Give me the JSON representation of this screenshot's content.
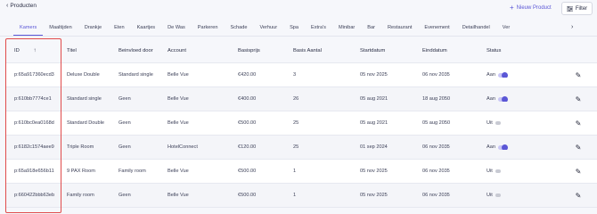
{
  "header": {
    "back_label": "Producten",
    "new_product_label": "Nieuw Product",
    "filter_label": "Filter"
  },
  "tabs": [
    {
      "label": "Kamers",
      "active": true
    },
    {
      "label": "Maaltijden"
    },
    {
      "label": "Drankje"
    },
    {
      "label": "Eten"
    },
    {
      "label": "Kaartjes"
    },
    {
      "label": "De Was"
    },
    {
      "label": "Parkeren"
    },
    {
      "label": "Schade"
    },
    {
      "label": "Verhuur"
    },
    {
      "label": "Spa"
    },
    {
      "label": "Extra's"
    },
    {
      "label": "Minibar"
    },
    {
      "label": "Bar"
    },
    {
      "label": "Restaurant"
    },
    {
      "label": "Evenement"
    },
    {
      "label": "Detailhandel"
    },
    {
      "label": "Ver"
    }
  ],
  "table": {
    "columns": {
      "id": "ID",
      "titel": "Titel",
      "beinvloed": "Beinvloed door",
      "account": "Account",
      "basisprijs": "Basisprijs",
      "aantal": "Basis Aantal",
      "start": "Startdatum",
      "eind": "Einddatum",
      "status": "Status"
    },
    "rows": [
      {
        "id": "p:65a917360ecd3",
        "titel": "Deluxe Double",
        "beinvloed": "Standard single",
        "account": "Belle Vue",
        "basisprijs": "€420.00",
        "aantal": "3",
        "start": "05 nov 2025",
        "eind": "06 nov 2035",
        "status": "Aan",
        "status_on": true
      },
      {
        "id": "p:610bb7774ce1",
        "titel": "Standard single",
        "beinvloed": "Geen",
        "account": "Belle Vue",
        "basisprijs": "€400.00",
        "aantal": "26",
        "start": "05 aug 2021",
        "eind": "18 aug 2050",
        "status": "Aan",
        "status_on": true
      },
      {
        "id": "p:610bc0ea0168d",
        "titel": "Standard Double",
        "beinvloed": "Geen",
        "account": "Belle Vue",
        "basisprijs": "€500.00",
        "aantal": "25",
        "start": "05 aug 2021",
        "eind": "05 aug 2050",
        "status": "Uit",
        "status_on": false
      },
      {
        "id": "p:6182c1574aee9",
        "titel": "Triple Room",
        "beinvloed": "Geen",
        "account": "HotelConnect",
        "basisprijs": "€120.00",
        "aantal": "25",
        "start": "01 sep 2024",
        "eind": "06 nov 2035",
        "status": "Aan",
        "status_on": true
      },
      {
        "id": "p:65a918e656b11",
        "titel": "9 PAX Room",
        "beinvloed": "Family room",
        "account": "Belle Vue",
        "basisprijs": "€500.00",
        "aantal": "1",
        "start": "05 nov 2025",
        "eind": "06 nov 2035",
        "status": "Uit",
        "status_on": false
      },
      {
        "id": "p:660422bbb63eb",
        "titel": "Family room",
        "beinvloed": "Geen",
        "account": "Belle Vue",
        "basisprijs": "€500.00",
        "aantal": "1",
        "start": "05 nov 2025",
        "eind": "06 nov 2035",
        "status": "Uit",
        "status_on": false
      }
    ]
  },
  "colors": {
    "accent": "#5b57d6",
    "highlight_border": "#e04b4b",
    "background": "#f6f7fb"
  },
  "icons": {
    "back": "chevron-left-icon",
    "new": "plus-icon",
    "filter": "filter-lines-icon",
    "tabs_more": "chevron-right-icon",
    "sort": "arrow-up-icon",
    "edit": "pencil-icon"
  }
}
